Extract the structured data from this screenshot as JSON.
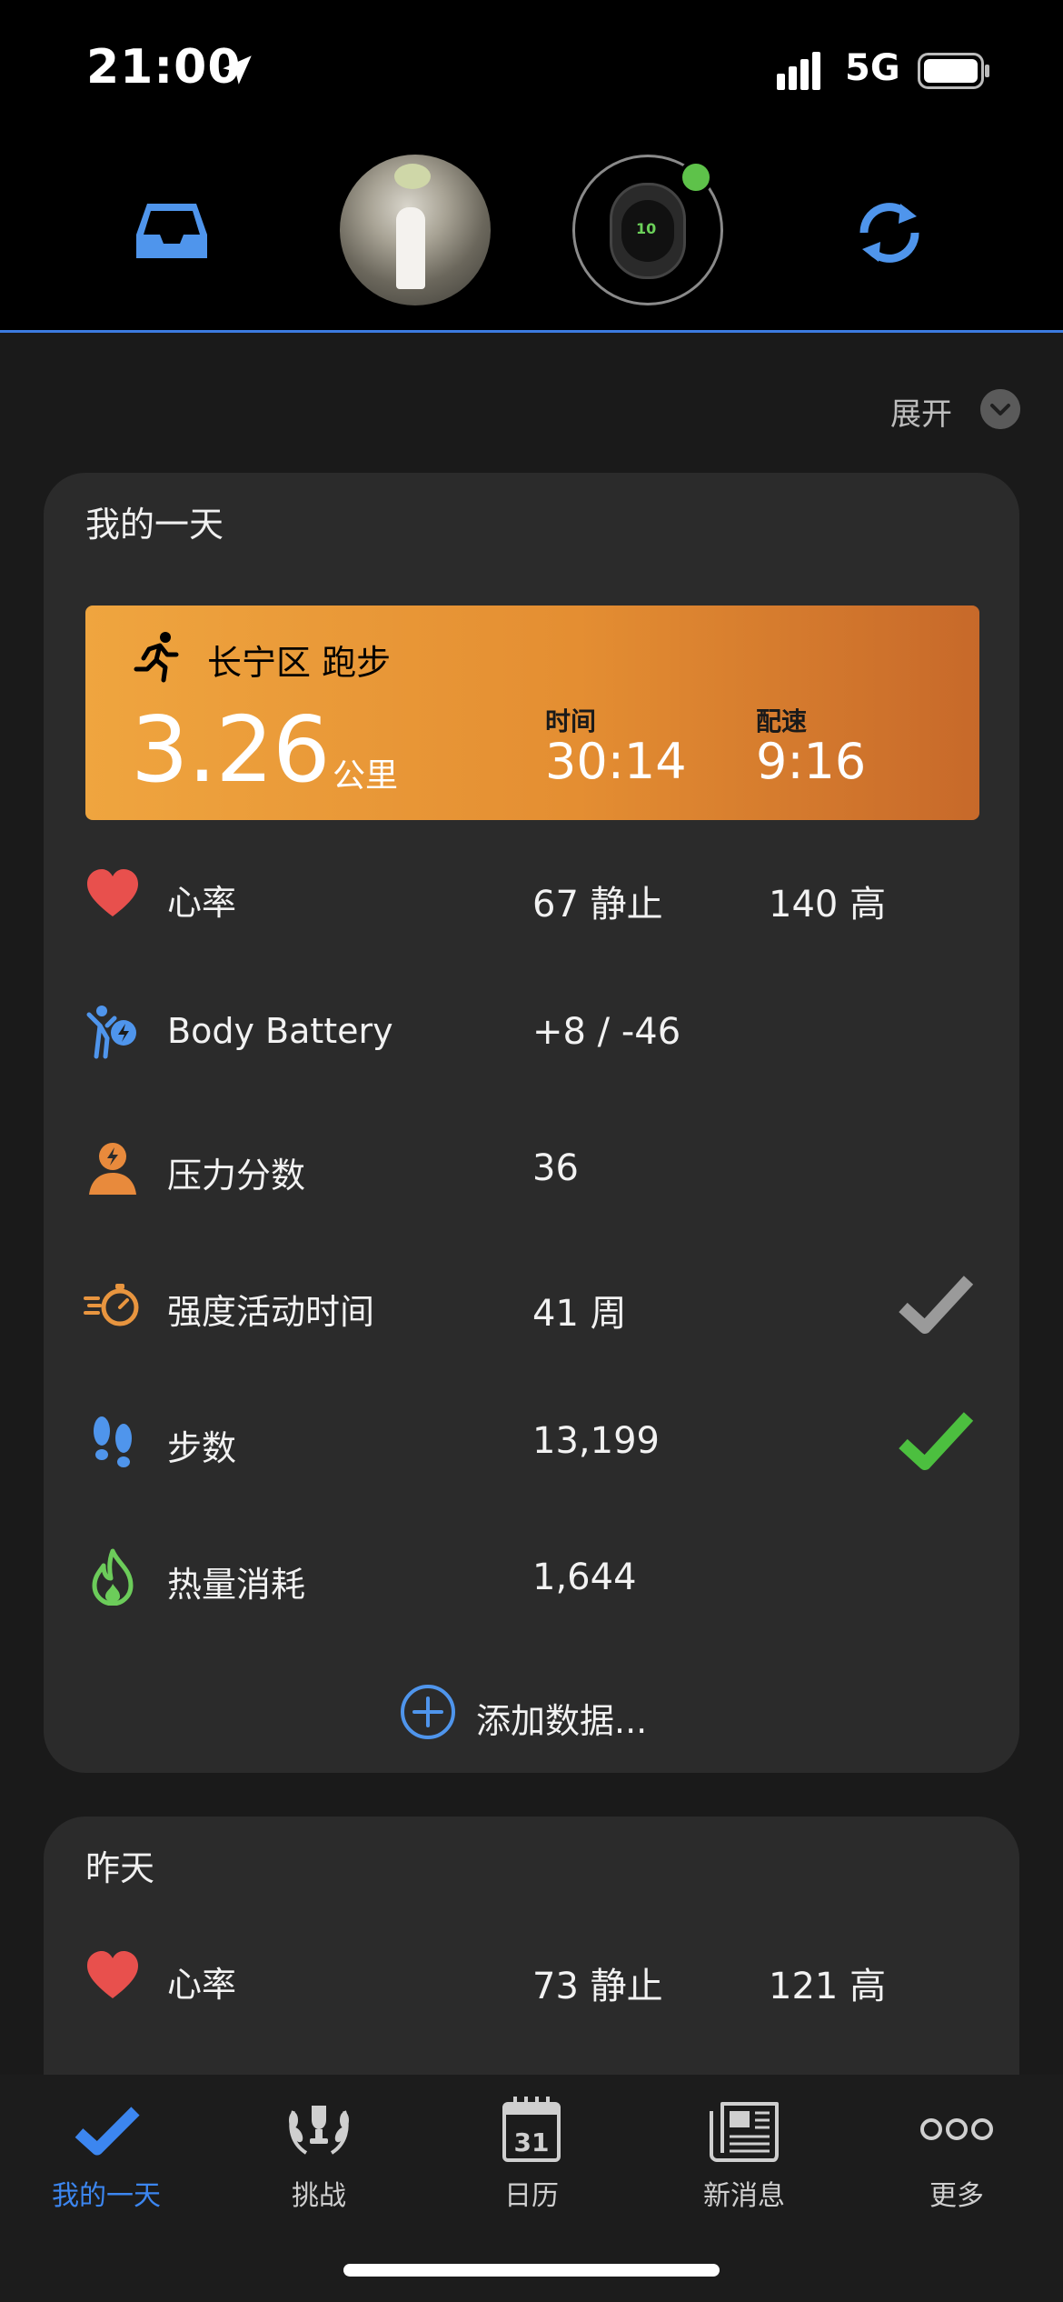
{
  "status_bar": {
    "time": "21:00",
    "network": "5G"
  },
  "header": {
    "icons": [
      "inbox-icon",
      "avatar",
      "watch-device",
      "sync-icon"
    ]
  },
  "expand": {
    "label": "展开"
  },
  "today": {
    "title": "我的一天",
    "activity": {
      "title": "长宁区 跑步",
      "distance": "3.26",
      "distance_unit": "公里",
      "time_label": "时间",
      "time_value": "30:14",
      "pace_label": "配速",
      "pace_value": "9:16"
    },
    "metrics": [
      {
        "label": "心率",
        "v1": "67 静止",
        "v2": "140 高"
      },
      {
        "label": "Body Battery",
        "v1": "+8 / -46"
      },
      {
        "label": "压力分数",
        "v1": "36"
      },
      {
        "label": "强度活动时间",
        "v1": "41 周"
      },
      {
        "label": "步数",
        "v1": "13,199"
      },
      {
        "label": "热量消耗",
        "v1": "1,644"
      }
    ],
    "add_data": "添加数据..."
  },
  "yesterday": {
    "title": "昨天",
    "metrics": [
      {
        "label": "心率",
        "v1": "73 静止",
        "v2": "121 高"
      }
    ]
  },
  "tabs": [
    {
      "label": "我的一天"
    },
    {
      "label": "挑战"
    },
    {
      "label": "日历",
      "day": "31"
    },
    {
      "label": "新消息"
    },
    {
      "label": "更多"
    }
  ],
  "colors": {
    "accent": "#3c86f0",
    "activity_orange": "#e48e32",
    "heart": "#e8504d",
    "check_gray": "#9a9a9a",
    "check_green": "#4cbf3f"
  }
}
